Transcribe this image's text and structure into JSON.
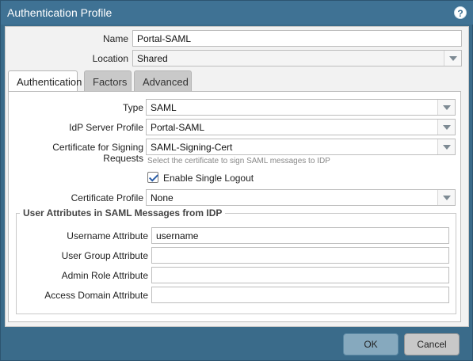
{
  "dialog": {
    "title": "Authentication Profile",
    "help_icon_glyph": "?"
  },
  "header_fields": {
    "name_label": "Name",
    "name_value": "Portal-SAML",
    "location_label": "Location",
    "location_value": "Shared"
  },
  "tabs": [
    {
      "label": "Authentication",
      "active": true
    },
    {
      "label": "Factors",
      "active": false
    },
    {
      "label": "Advanced",
      "active": false
    }
  ],
  "auth": {
    "type_label": "Type",
    "type_value": "SAML",
    "idp_label": "IdP Server Profile",
    "idp_value": "Portal-SAML",
    "cert_sign_label": "Certificate for Signing Requests",
    "cert_sign_value": "SAML-Signing-Cert",
    "cert_sign_hint": "Select the certificate to sign SAML messages to IDP",
    "single_logout_label": "Enable Single Logout",
    "single_logout_checked": true,
    "cert_profile_label": "Certificate Profile",
    "cert_profile_value": "None"
  },
  "user_attributes": {
    "title": "User Attributes in SAML Messages from IDP",
    "username_label": "Username Attribute",
    "username_value": "username",
    "user_group_label": "User Group Attribute",
    "user_group_value": "",
    "admin_role_label": "Admin Role Attribute",
    "admin_role_value": "",
    "access_domain_label": "Access Domain Attribute",
    "access_domain_value": ""
  },
  "buttons": {
    "ok": "OK",
    "cancel": "Cancel"
  },
  "colors": {
    "titlebar": "#3f7294",
    "ok_button": "#86a9be",
    "cancel_button": "#c8c8c8"
  }
}
